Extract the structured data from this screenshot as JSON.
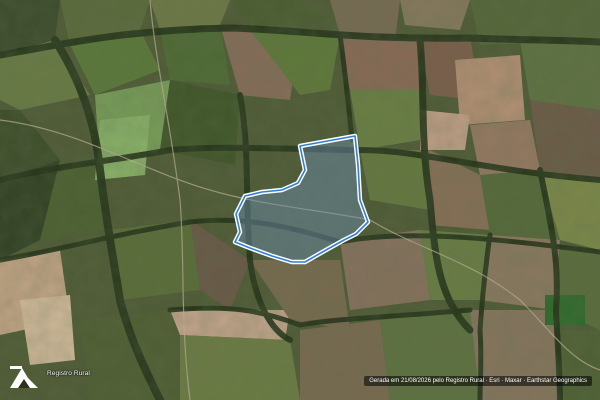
{
  "map": {
    "style": "satellite",
    "boundary_color": "#ffffff",
    "boundary_accent_color": "#2f7fd6",
    "boundary_fill_color": "#6b8fb3"
  },
  "branding": {
    "logo_icon": "registro-rural-logo-icon",
    "label": "Registro Rural"
  },
  "attribution": {
    "text": "Gerada em 21/08/2026 pelo Registro Rural · Esri · Maxar · Earthstar Geographics"
  }
}
